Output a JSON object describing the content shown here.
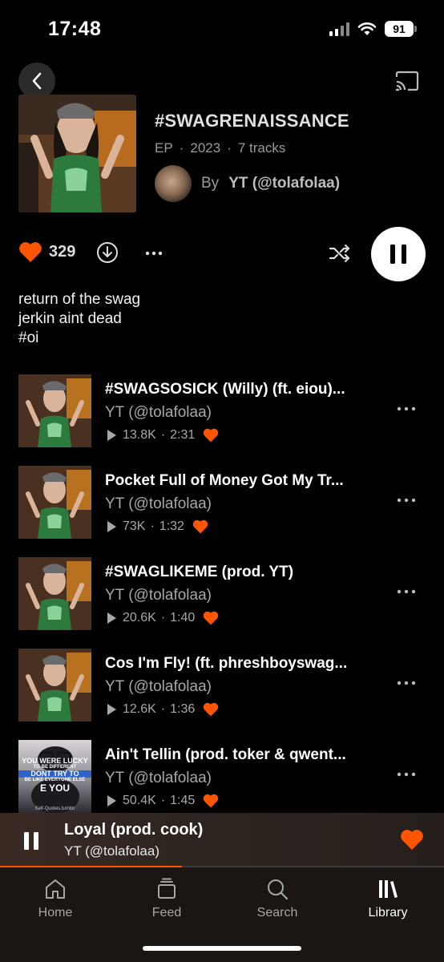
{
  "status_bar": {
    "time": "17:48",
    "battery": "91"
  },
  "album": {
    "title": "#SWAGRENAISSANCE",
    "type": "EP",
    "year": "2023",
    "track_count": "7 tracks",
    "by_label": "By",
    "artist": "YT (@tolafolaa)"
  },
  "actions": {
    "like_count": "329"
  },
  "description": [
    "return of the swag",
    "jerkin aint dead",
    "#oi"
  ],
  "tracks": [
    {
      "title": "#SWAGSOSICK (Willy) (ft. eiou)...",
      "artist": "YT (@tolafolaa)",
      "plays": "13.8K",
      "duration": "2:31"
    },
    {
      "title": "Pocket Full of Money Got My Tr...",
      "artist": "YT (@tolafolaa)",
      "plays": "73K",
      "duration": "1:32"
    },
    {
      "title": "#SWAGLIKEME (prod. YT)",
      "artist": "YT (@tolafolaa)",
      "plays": "20.6K",
      "duration": "1:40"
    },
    {
      "title": "Cos I'm Fly! (ft. phreshboyswag...",
      "artist": "YT (@tolafolaa)",
      "plays": "12.6K",
      "duration": "1:36"
    },
    {
      "title": "Ain't Tellin (prod. toker & qwent...",
      "artist": "YT (@tolafolaa)",
      "plays": "50.4K",
      "duration": "1:45",
      "art_text": [
        "YOU WERE LUCKY",
        "TO BE DIFFERENT",
        "DONT TRY TO",
        "BE LIKE EVERYONE ELSE",
        "E YOU",
        "Self-Quotes.tumblr"
      ]
    }
  ],
  "now_playing": {
    "title": "Loyal (prod. cook)",
    "artist": "YT (@tolafolaa)",
    "progress": 0.41
  },
  "nav": {
    "home": "Home",
    "feed": "Feed",
    "search": "Search",
    "library": "Library",
    "active": "Library"
  },
  "colors": {
    "accent": "#ff5500",
    "background": "#000000"
  }
}
